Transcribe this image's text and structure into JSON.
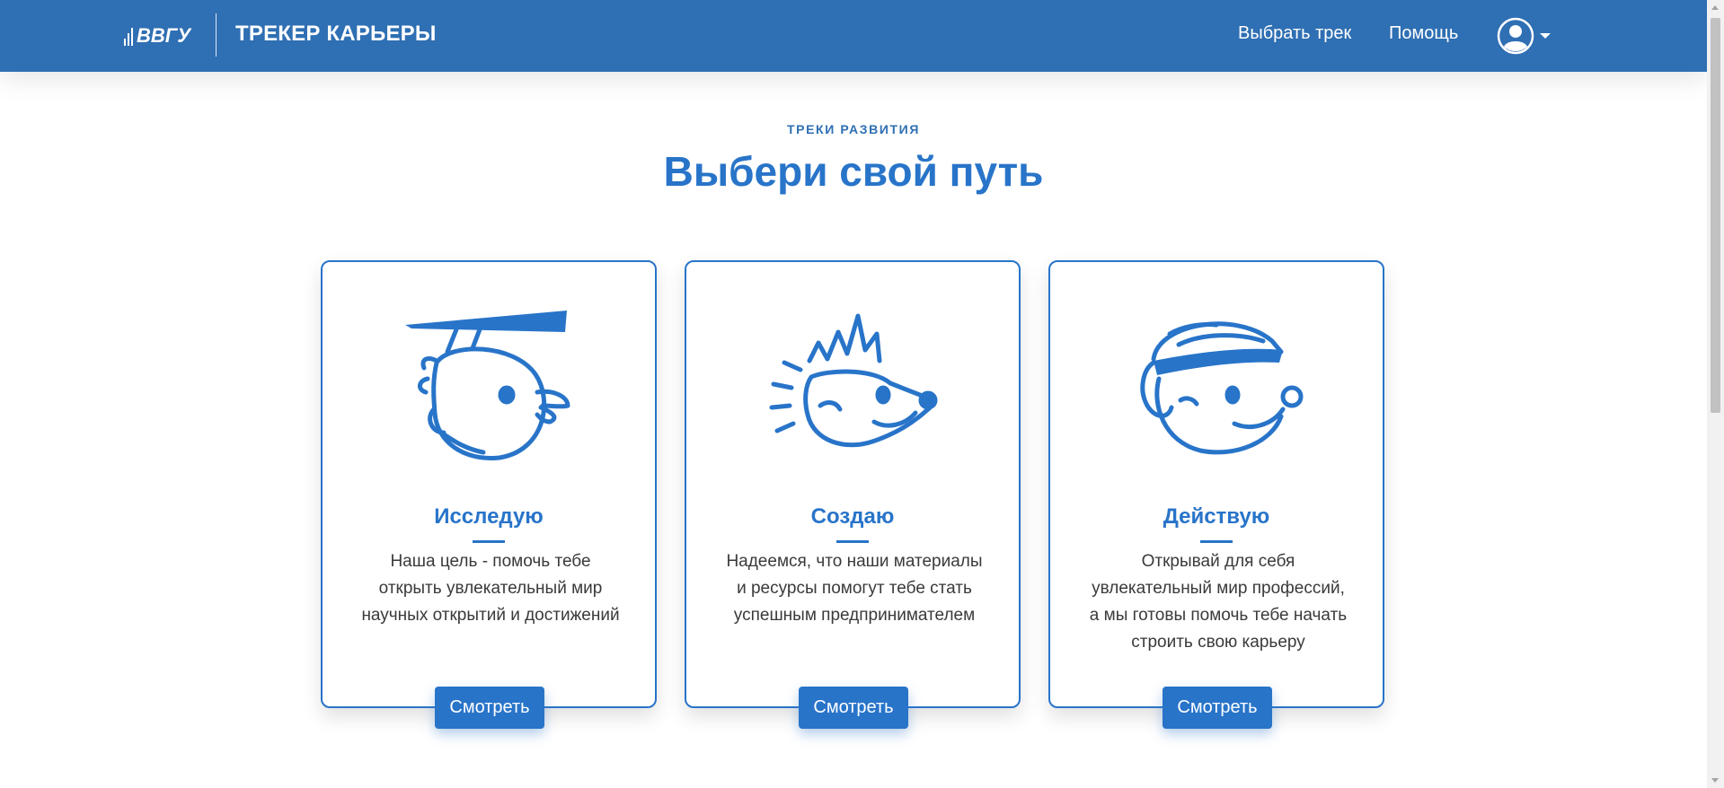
{
  "header": {
    "logo_text": "ВВГУ",
    "app_title": "ТРЕКЕР КАРЬЕРЫ",
    "nav": [
      {
        "label": "Выбрать трек"
      },
      {
        "label": "Помощь"
      }
    ],
    "user_icon": "user-circle-icon",
    "background_color": "#2f6fb3"
  },
  "section": {
    "eyebrow": "ТРЕКИ РАЗВИТИЯ",
    "headline": "Выбери свой путь",
    "accent_color": "#2874c9"
  },
  "cards": [
    {
      "title": "Исследую",
      "description": "Наша цель - помочь тебе открыть увлекательный мир научных открытий и достижений",
      "button": "Смотреть",
      "icon": "owl-scholar-icon"
    },
    {
      "title": "Создаю",
      "description": "Надеемся, что наши материалы и ресурсы помогут тебе стать успешным предпринимателем",
      "button": "Смотреть",
      "icon": "hedgehog-icon"
    },
    {
      "title": "Действую",
      "description": "Открывай для себя увлекательный мир профессий, а мы готовы помочь тебе начать строить свою карьеру",
      "button": "Смотреть",
      "icon": "bear-helmet-icon"
    }
  ]
}
